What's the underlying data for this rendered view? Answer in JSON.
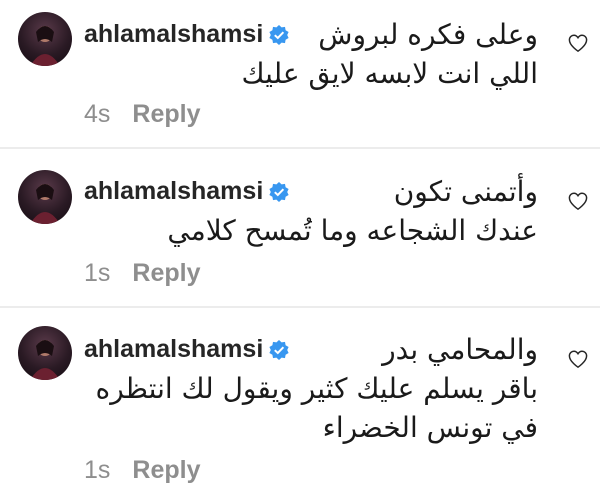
{
  "comments": [
    {
      "username": "ahlamalshamsi",
      "lines": [
        "وعلى فكره لبروش",
        "اللي انت لابسه لايق عليك"
      ],
      "time": "4s",
      "reply_label": "Reply"
    },
    {
      "username": "ahlamalshamsi",
      "lines": [
        "وأتمنى تكون",
        "عندك الشجاعه وما تُمسح كلامي"
      ],
      "time": "1s",
      "reply_label": "Reply"
    },
    {
      "username": "ahlamalshamsi",
      "lines": [
        "والمحامي بدر",
        "باقر يسلم عليك كثير ويقول لك انتظره",
        "في تونس الخضراء"
      ],
      "time": "1s",
      "reply_label": "Reply"
    }
  ],
  "icons": {
    "verified": "verified-badge-icon",
    "like": "heart-outline-icon",
    "verified_color": "#3897f0"
  }
}
